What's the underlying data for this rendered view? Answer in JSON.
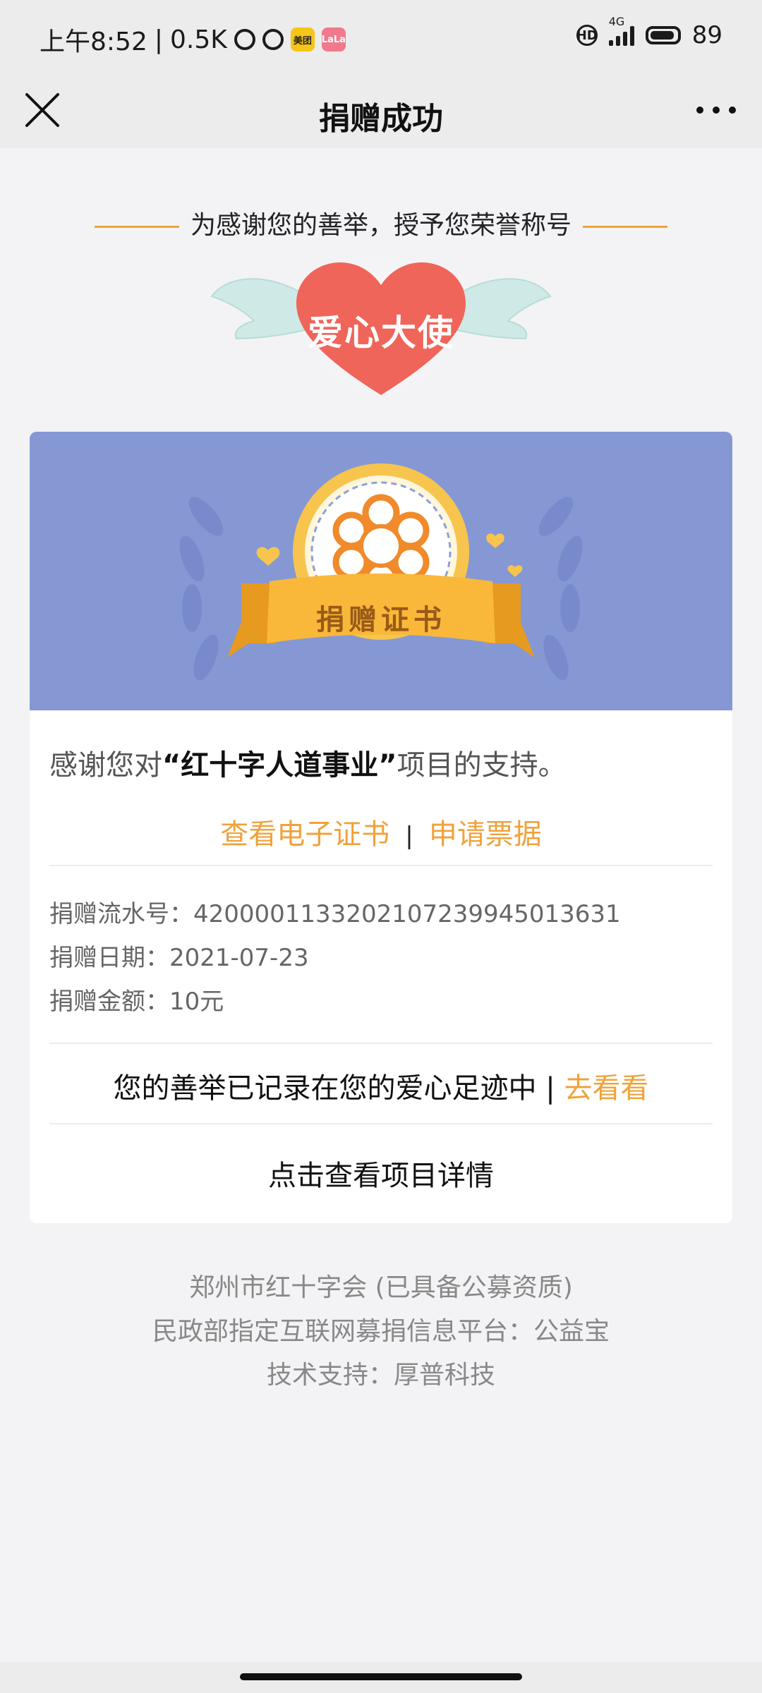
{
  "status_bar": {
    "time": "上午8:52",
    "speed": "0.5K",
    "app1": "美团",
    "app2": "LaLa",
    "hd": "HD",
    "network": "4G",
    "battery": "89"
  },
  "nav": {
    "title": "捐赠成功"
  },
  "honor": {
    "line": "为感谢您的善举，授予您荣誉称号",
    "badge": "爱心大使"
  },
  "certificate": {
    "ribbon": "捐赠证书",
    "thanks_prefix": "感谢您对",
    "project": "“红十字人道事业”",
    "thanks_suffix": "项目的支持。",
    "link_cert": "查看电子证书",
    "link_sep": "|",
    "link_receipt": "申请票据",
    "serial_label": "捐赠流水号：",
    "serial_value": "4200001133202107239945013631",
    "date_label": "捐赠日期：",
    "date_value": "2021-07-23",
    "amount_label": "捐赠金额：",
    "amount_value": "10元",
    "record_text": "您的善举已记录在您的爱心足迹中 | ",
    "record_link": "去看看",
    "detail": "点击查看项目详情"
  },
  "footer": {
    "line1": "郑州市红十字会 (已具备公募资质)",
    "line2": "民政部指定互联网募捐信息平台：公益宝",
    "line3": "技术支持：厚普科技"
  },
  "colors": {
    "accent": "#f0a23a",
    "banner": "#8598d4",
    "heart": "#f0655a"
  }
}
